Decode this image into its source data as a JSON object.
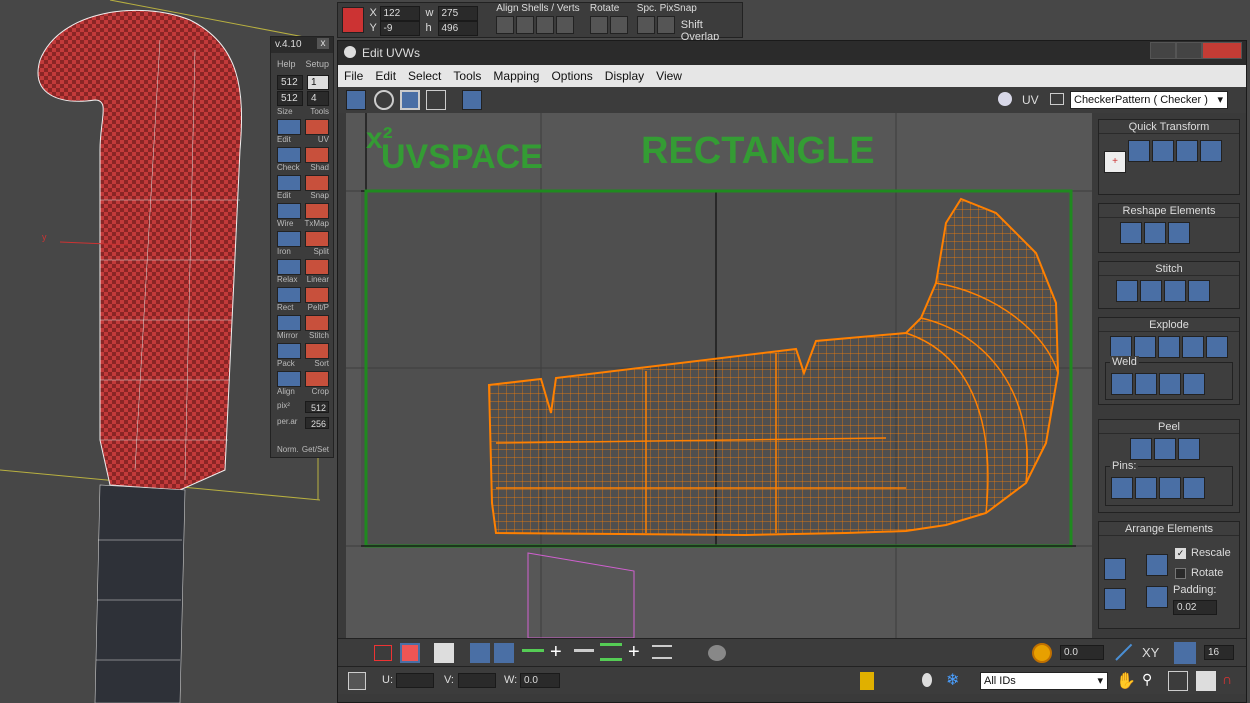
{
  "top_toolbar": {
    "x_label": "X",
    "x_value": "122",
    "y_label": "Y",
    "y_value": "-9",
    "w_label": "w",
    "w_value": "275",
    "h_label": "h",
    "h_value": "496",
    "align_label": "Align Shells / Verts",
    "rotate_label": "Rotate",
    "spc_label": "Spc. PixSnap",
    "shift_overlap": "Shift Overlap"
  },
  "float_panel": {
    "title": "v.4.10",
    "close": "x",
    "help": "Help",
    "setup": "Setup",
    "res1": "512",
    "sel1": "1",
    "res2": "512",
    "val2": "4",
    "size": "Size",
    "tools": "Tools",
    "rows": [
      {
        "l": "Edit",
        "r": "UV"
      },
      {
        "l": "Check",
        "r": "Shad"
      },
      {
        "l": "Edit",
        "r": "Snap"
      },
      {
        "l": "Wire",
        "r": "TxMap"
      },
      {
        "l": "Iron",
        "r": "Split"
      },
      {
        "l": "Relax",
        "r": "Linear"
      },
      {
        "l": "Rect",
        "r": "Pelt/P"
      },
      {
        "l": "Mirror",
        "r": "Stitch"
      },
      {
        "l": "Pack",
        "r": "Sort"
      },
      {
        "l": "Align",
        "r": "Crop"
      }
    ],
    "pix": "pix²",
    "v512": "512",
    "perarea": "per.ar",
    "v256": "256",
    "norm": "Norm.",
    "get_set": "Get/Set"
  },
  "window": {
    "title": "Edit UVWs",
    "menus": [
      "File",
      "Edit",
      "Select",
      "Tools",
      "Mapping",
      "Options",
      "Display",
      "View"
    ],
    "uv_label": "UV",
    "pattern": "CheckerPattern  ( Checker )"
  },
  "canvas": {
    "annotation_1": "x²",
    "annotation_2": "UVSPACE",
    "annotation_3": "RECTANGLE",
    "viewport_axis": "y"
  },
  "right_panel": {
    "quick_transform": "Quick Transform",
    "reshape": "Reshape Elements",
    "stitch": "Stitch",
    "explode": "Explode",
    "weld": "Weld",
    "peel": "Peel",
    "pins": "Pins:",
    "arrange": "Arrange Elements",
    "rescale": "Rescale",
    "rotate": "Rotate",
    "padding": "Padding:",
    "padding_value": "0.02",
    "rescale_checked": true,
    "rotate_checked": false
  },
  "bottom": {
    "soft_value": "0.0",
    "xy": "XY",
    "grid_value": "16",
    "u_label": "U:",
    "v_label": "V:",
    "w_label": "W:",
    "w_value": "0.0",
    "ids": "All IDs"
  },
  "colors": {
    "uv_mesh": "#ff8000",
    "uv_rect": "#1f8a1f",
    "annotation": "#2ea82e",
    "model_red": "#c23a3a",
    "accent_blue": "#4a6fa5"
  }
}
